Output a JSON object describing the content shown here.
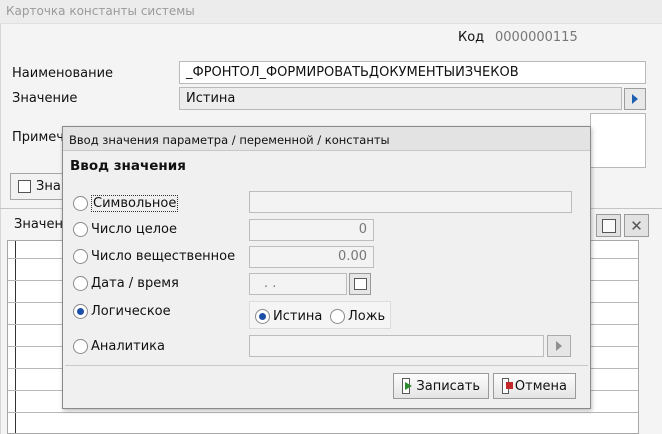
{
  "main_window": {
    "title": "Карточка константы системы",
    "code_label": "Код",
    "code_value": "0000000115",
    "name_label": "Наименование",
    "name_value": "_ФРОНТОЛ_ФОРМИРОВАТЬДОКУМЕНТЫИЗЧЕКОВ",
    "value_label": "Значение",
    "value_value": "Истина",
    "note_label": "Примеч",
    "checkbox_label": "Зна",
    "values_label": "Значен"
  },
  "dialog": {
    "title": "Ввод значения параметра / переменной / константы",
    "heading": "Ввод значения",
    "options": {
      "symbolic": "Символьное",
      "integer": "Число целое",
      "real": "Число вещественное",
      "datetime": "Дата / время",
      "logical": "Логическое",
      "analytics": "Аналитика"
    },
    "selected_option": "logical",
    "integer_value": "0",
    "real_value": "0.00",
    "date_value": " .  .",
    "logical_true": "Истина",
    "logical_false": "Ложь",
    "logical_selected": "true",
    "save_button": "Записать",
    "cancel_button": "Отмена"
  },
  "colors": {
    "accent": "#1d4fa8",
    "title_text": "#9a9a9a"
  }
}
